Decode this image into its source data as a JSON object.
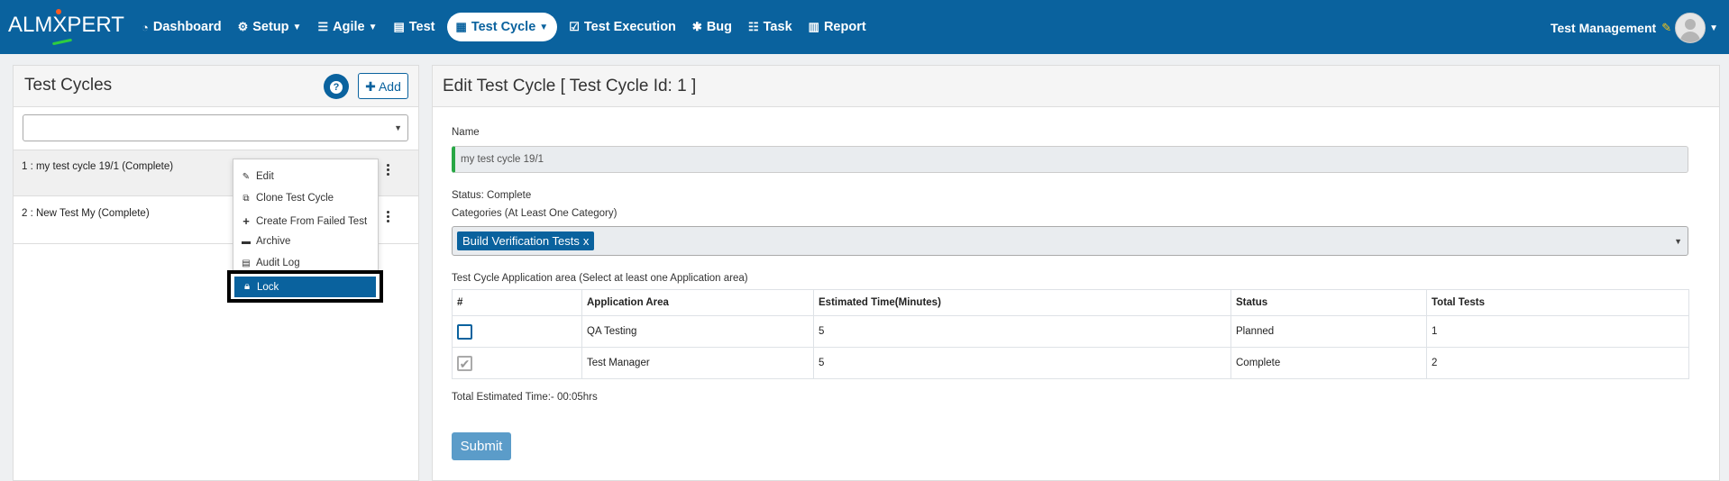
{
  "brand": {
    "logo_text_left": "ALM",
    "logo_text_x": "X",
    "logo_text_right": "PERT"
  },
  "nav": [
    {
      "label": "Dashboard",
      "icon": "dashboard-icon",
      "caret": false,
      "active": false
    },
    {
      "label": "Setup",
      "icon": "gears-icon",
      "caret": true,
      "active": false
    },
    {
      "label": "Agile",
      "icon": "list-icon",
      "caret": true,
      "active": false
    },
    {
      "label": "Test",
      "icon": "file-icon",
      "caret": false,
      "active": false
    },
    {
      "label": "Test Cycle",
      "icon": "grid-icon",
      "caret": true,
      "active": true
    },
    {
      "label": "Test Execution",
      "icon": "check-square-icon",
      "caret": false,
      "active": false
    },
    {
      "label": "Bug",
      "icon": "bug-icon",
      "caret": false,
      "active": false
    },
    {
      "label": "Task",
      "icon": "tasks-icon",
      "caret": false,
      "active": false
    },
    {
      "label": "Report",
      "icon": "report-icon",
      "caret": false,
      "active": false
    }
  ],
  "user": {
    "name": "Test Management"
  },
  "left": {
    "title": "Test Cycles",
    "help_label": "?",
    "add_label": "Add",
    "cycles": [
      {
        "label": "1 : my test cycle 19/1 (Complete)"
      },
      {
        "label": "2 : New Test My (Complete)"
      }
    ]
  },
  "menu": {
    "items": [
      {
        "label": "Edit",
        "icon": "pencil-icon",
        "glyph": "✎"
      },
      {
        "label": "Clone Test Cycle",
        "icon": "clone-icon",
        "glyph": "⧉"
      },
      {
        "label": "Create From Failed Test",
        "icon": "plus-icon",
        "glyph": "+"
      },
      {
        "label": "Archive",
        "icon": "archive-icon",
        "glyph": "▬"
      },
      {
        "label": "Audit Log",
        "icon": "document-icon",
        "glyph": "▤"
      }
    ],
    "highlighted": {
      "label": "Lock",
      "icon": "lock-icon"
    }
  },
  "form": {
    "title": "Edit Test Cycle  [ Test Cycle Id: 1 ]",
    "name_label": "Name",
    "name_value": "my test cycle 19/1",
    "status_text": "Status: Complete",
    "categories_label": "Categories (At Least One Category)",
    "category_tag": "Build Verification Tests",
    "category_tag_remove": "x",
    "app_area_label": "Test Cycle Application area (Select at least one Application area)",
    "table": {
      "headers": [
        "#",
        "Application Area",
        "Estimated Time(Minutes)",
        "Status",
        "Total Tests"
      ],
      "rows": [
        {
          "checked": false,
          "area": "QA Testing",
          "time": "5",
          "status": "Planned",
          "total": "1"
        },
        {
          "checked": true,
          "area": "Test Manager",
          "time": "5",
          "status": "Complete",
          "total": "2"
        }
      ]
    },
    "total_time": "Total Estimated Time:- 00:05hrs",
    "submit_label": "Submit"
  },
  "colors": {
    "nav_bg": "#0a629e",
    "accent_green": "#28a745",
    "submit_bg": "#5b9cc9"
  }
}
